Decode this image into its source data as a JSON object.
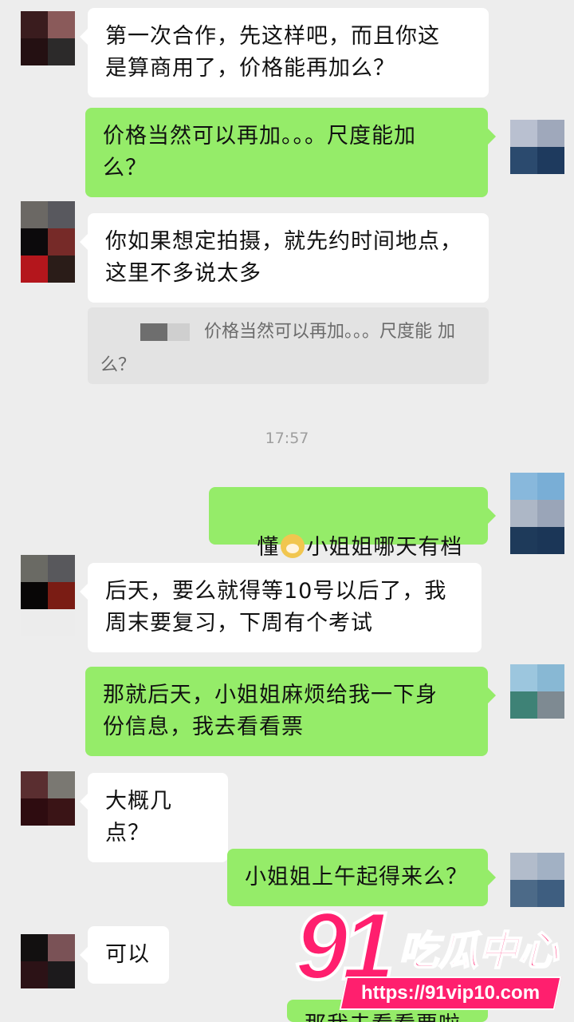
{
  "messages": [
    {
      "text": "第一次合作，先这样吧，而且你这\n是算商用了，价格能再加么？"
    },
    {
      "text": "价格当然可以再加。。。尺度能加\n么？"
    },
    {
      "text": "你如果想定拍摄，就先约时间地点，\n这里不多说太多"
    },
    {
      "quote": "价格当然可以再加。。。尺度能\n加么？"
    },
    {
      "text_before": "懂",
      "text_after": "小姐姐哪天有档期"
    },
    {
      "text": "后天，要么就得等10号以后了，我\n周末要复习，下周有个考试"
    },
    {
      "text": "那就后天，小姐姐麻烦给我一下身\n份信息，我去看看票"
    },
    {
      "text": "大概几点？"
    },
    {
      "text": "小姐姐上午起得来么？"
    },
    {
      "text": "可以"
    },
    {
      "text": "那我去看看票啦"
    }
  ],
  "timestamp": "17:57",
  "emoji": "doge-emoji",
  "watermark": {
    "number": "91",
    "name": "吃瓜中心",
    "url": "https://91vip10.com"
  },
  "colors": {
    "background": "#ededed",
    "incoming_bubble": "#ffffff",
    "outgoing_bubble": "#95ec69",
    "watermark": "#ff1f6e"
  }
}
